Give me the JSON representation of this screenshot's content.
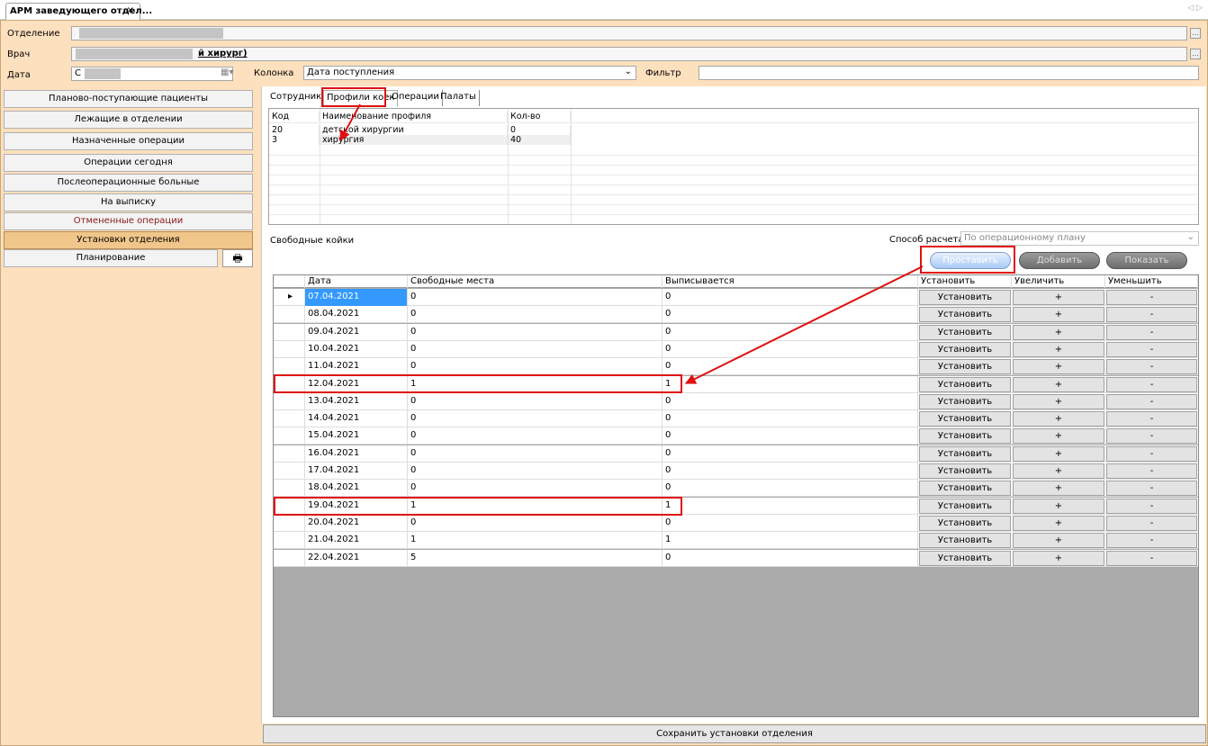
{
  "window": {
    "tab_title": "АРМ заведующего отдел...",
    "close": "×",
    "nav": "◁ ▷"
  },
  "form": {
    "dept_label": "Отделение",
    "doctor_label": "Врач",
    "doctor_value": "й хирург)",
    "date_label": "Дата",
    "date_value": "C",
    "column_label": "Колонка",
    "column_value": "Дата поступления",
    "filter_label": "Фильтр",
    "filter_value": "",
    "ellipsis": "..."
  },
  "nav": [
    "Планово-поступающие пациенты",
    "Лежащие в отделении",
    "Назначенные операции",
    "Операции сегодня",
    "Послеоперационные больные",
    "На выписку",
    "Отмененные операции",
    "Установки отделения",
    "Планирование"
  ],
  "tabs": [
    "Сотрудники",
    "Профили коек",
    "Операции",
    "Палаты"
  ],
  "profiles": {
    "headers": [
      "Код",
      "Наименование профиля",
      "Кол-во"
    ],
    "rows": [
      [
        "20",
        "детской хирургии",
        "0"
      ],
      [
        "3",
        "хирургия",
        "40"
      ]
    ]
  },
  "free_beds": {
    "title": "Свободные койки",
    "calc_label": "Способ расчета",
    "calc_value": "По операционному плану"
  },
  "buttons": {
    "place": "Проставить",
    "add": "Добавить",
    "show": "Показать"
  },
  "grid": {
    "headers": [
      "Дата",
      "Свободные места",
      "Выписывается",
      "Установить",
      "Увеличить",
      "Уменьшить"
    ],
    "btn_set": "Установить",
    "btn_inc": "+",
    "btn_dec": "-",
    "rows": [
      [
        "07.04.2021",
        "0",
        "0"
      ],
      [
        "08.04.2021",
        "0",
        "0"
      ],
      [
        "09.04.2021",
        "0",
        "0"
      ],
      [
        "10.04.2021",
        "0",
        "0"
      ],
      [
        "11.04.2021",
        "0",
        "0"
      ],
      [
        "12.04.2021",
        "1",
        "1"
      ],
      [
        "13.04.2021",
        "0",
        "0"
      ],
      [
        "14.04.2021",
        "0",
        "0"
      ],
      [
        "15.04.2021",
        "0",
        "0"
      ],
      [
        "16.04.2021",
        "0",
        "0"
      ],
      [
        "17.04.2021",
        "0",
        "0"
      ],
      [
        "18.04.2021",
        "0",
        "0"
      ],
      [
        "19.04.2021",
        "1",
        "1"
      ],
      [
        "20.04.2021",
        "0",
        "0"
      ],
      [
        "21.04.2021",
        "1",
        "1"
      ],
      [
        "22.04.2021",
        "5",
        "0"
      ]
    ]
  },
  "save_label": "Сохранить установки отделения",
  "colors": {
    "panel": "#fde0be",
    "active_nav": "#f0c68a",
    "annotation": "#e01010",
    "selection": "#3399ff"
  }
}
